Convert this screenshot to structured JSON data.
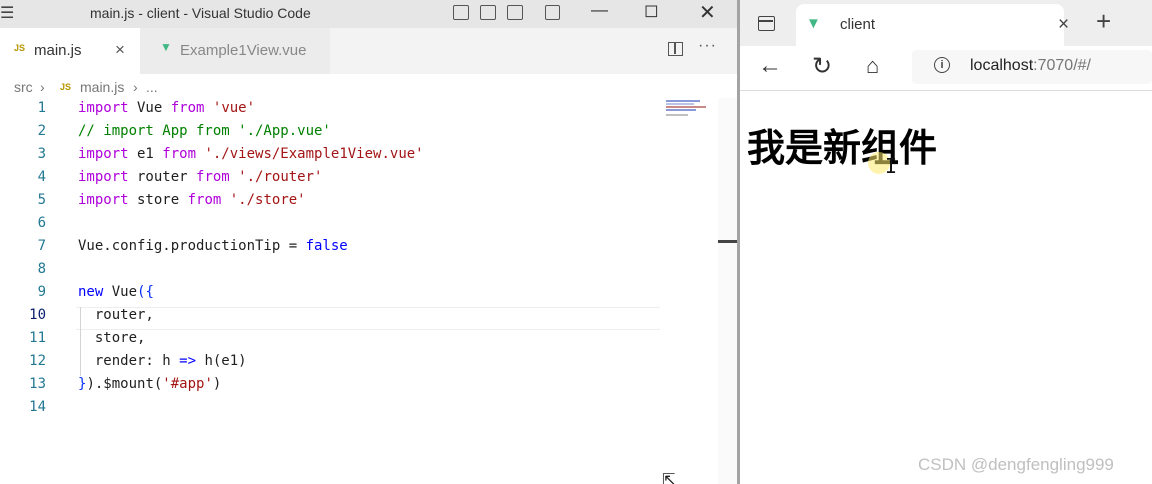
{
  "vscode": {
    "window_title": "main.js - client - Visual Studio Code",
    "menu_icon": "hamburger-icon",
    "window_controls": [
      "minimize",
      "maximize",
      "close"
    ],
    "tabs": [
      {
        "badge": "JS",
        "label": "main.js",
        "active": true,
        "close": "×"
      },
      {
        "label": "Example1View.vue",
        "active": false
      }
    ],
    "breadcrumb": {
      "folder": "src",
      "badge": "JS",
      "file": "main.js",
      "more": "..."
    },
    "code_lines": [
      {
        "n": "1",
        "text": "import Vue from 'vue'"
      },
      {
        "n": "2",
        "text": "// import App from './App.vue'"
      },
      {
        "n": "3",
        "text": "import e1 from './views/Example1View.vue'"
      },
      {
        "n": "4",
        "text": "import router from './router'"
      },
      {
        "n": "5",
        "text": "import store from './store'"
      },
      {
        "n": "6",
        "text": ""
      },
      {
        "n": "7",
        "text": "Vue.config.productionTip = false"
      },
      {
        "n": "8",
        "text": ""
      },
      {
        "n": "9",
        "text": "new Vue({"
      },
      {
        "n": "10",
        "text": "  router,"
      },
      {
        "n": "11",
        "text": "  store,"
      },
      {
        "n": "12",
        "text": "  render: h => h(e1)"
      },
      {
        "n": "13",
        "text": "}).$mount('#app')"
      },
      {
        "n": "14",
        "text": ""
      }
    ],
    "current_line": "10"
  },
  "browser": {
    "tab_title": "client",
    "tab_close": "×",
    "new_tab": "+",
    "url_host": "localhost",
    "url_rest": ":7070/#/",
    "page_heading": "我是新组件"
  },
  "watermark": "CSDN @dengfengling999",
  "colors": {
    "keyword": "#0000ff",
    "control": "#af00db",
    "string": "#a31515",
    "comment": "#008000",
    "line_number": "#237893",
    "vue_green": "#41b883"
  }
}
